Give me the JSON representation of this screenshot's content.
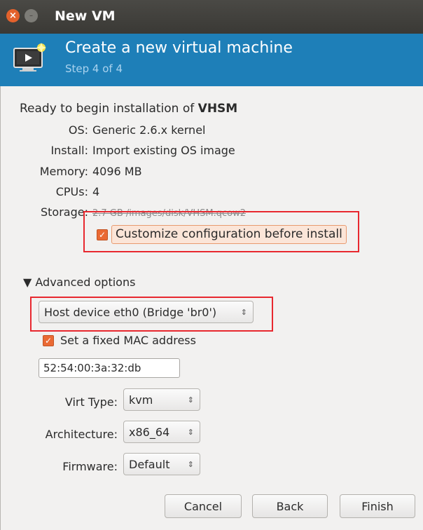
{
  "window": {
    "title": "New VM",
    "close_glyph": "×",
    "min_glyph": "–"
  },
  "header": {
    "title": "Create a new virtual machine",
    "step": "Step 4 of 4",
    "icon": "virtual-machine-monitor-icon"
  },
  "summary": {
    "ready_prefix": "Ready to begin installation of ",
    "vm_name": "VHSM",
    "rows": [
      {
        "label": "OS:",
        "value": "Generic 2.6.x kernel"
      },
      {
        "label": "Install:",
        "value": "Import existing OS image"
      },
      {
        "label": "Memory:",
        "value": "4096 MB"
      },
      {
        "label": "CPUs:",
        "value": "4"
      },
      {
        "label": "Storage:",
        "value": "2.7 GB /images/disk/VHSM.qcow2"
      }
    ]
  },
  "customize": {
    "checked": true,
    "label": "Customize configuration before install"
  },
  "advanced": {
    "toggle_label": "▼ Advanced options",
    "network_selected": "Host device eth0 (Bridge 'br0')",
    "mac_checked": true,
    "mac_label": "Set a fixed MAC address",
    "mac_value": "52:54:00:3a:32:db",
    "virt_type_label": "Virt Type:",
    "virt_type_value": "kvm",
    "arch_label": "Architecture:",
    "arch_value": "x86_64",
    "firmware_label": "Firmware:",
    "firmware_value": "Default"
  },
  "buttons": {
    "cancel": "Cancel",
    "back": "Back",
    "finish": "Finish"
  },
  "colors": {
    "header_bg": "#1e7fb8",
    "titlebar_bg": "#3a3935",
    "checkbox_orange": "#ea6a34",
    "highlight_red": "#e8282f"
  }
}
